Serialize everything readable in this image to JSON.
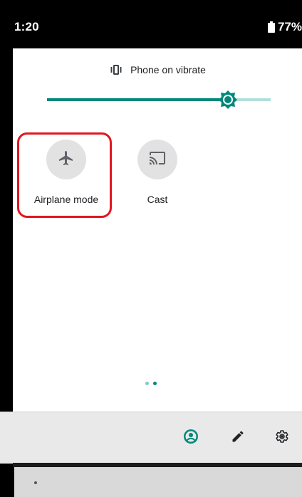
{
  "status_bar": {
    "time": "1:20",
    "battery_percent": "77%",
    "battery_icon": "battery-icon"
  },
  "quick_settings": {
    "ringer": {
      "icon": "vibrate-icon",
      "label": "Phone on vibrate"
    },
    "brightness": {
      "level": 0.81,
      "icon": "brightness-icon",
      "accent_color": "#00897b",
      "track_color": "#b2dfdb"
    },
    "tiles": [
      {
        "label": "Airplane mode",
        "icon": "airplane-icon",
        "highlighted": true
      },
      {
        "label": "Cast",
        "icon": "cast-icon",
        "highlighted": false
      }
    ],
    "highlight_color": "#e0171f",
    "pages": {
      "count": 2,
      "current": 2
    }
  },
  "bottom_bar": {
    "icons": [
      "user-icon",
      "edit-icon",
      "settings-icon"
    ],
    "user_icon_color": "#00897b"
  }
}
